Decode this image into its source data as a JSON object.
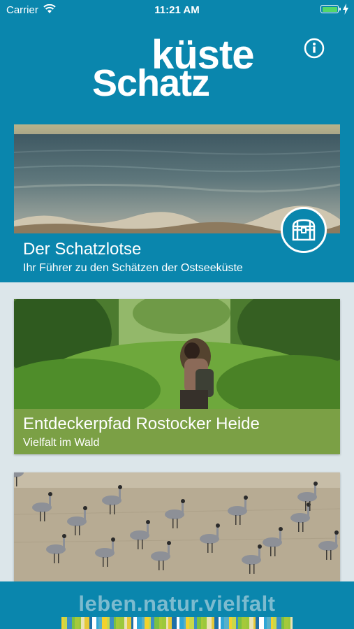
{
  "status_bar": {
    "carrier": "Carrier",
    "time": "11:21 AM"
  },
  "logo": {
    "top": "küste",
    "bottom": "Schatz"
  },
  "cards": [
    {
      "title": "Der Schatzlotse",
      "subtitle": "Ihr Führer zu den Schätzen der Ostseeküste"
    },
    {
      "title": "Entdeckerpfad Rostocker Heide",
      "subtitle": "Vielfalt im Wald"
    },
    {
      "title": "",
      "subtitle": ""
    }
  ],
  "footer": {
    "text": "leben.natur.vielfalt"
  },
  "colors": {
    "brand_blue": "#0a86ad",
    "forest_green": "#7ba045",
    "background": "#dce6ea"
  },
  "icons": [
    "wifi-icon",
    "battery-icon",
    "charging-bolt-icon",
    "info-icon",
    "treasure-chest-icon"
  ]
}
